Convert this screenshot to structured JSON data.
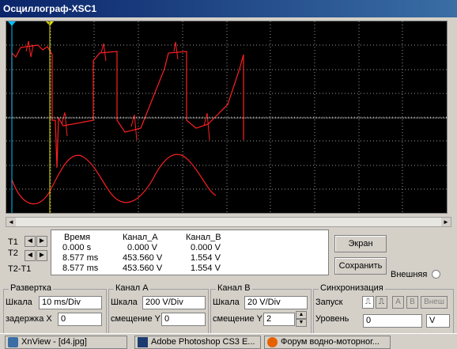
{
  "window": {
    "title": "Осциллограф-XSC1"
  },
  "screen": {
    "cursor1_label": "1",
    "cursor2_label": "2",
    "trace_color": "#ff2020",
    "grid_color": "#9a9a9a",
    "marker_color": "#e6e600"
  },
  "readout": {
    "row_labels": [
      "T1",
      "T2",
      "T2-T1"
    ],
    "headers": {
      "time": "Время",
      "chA": "Канал_A",
      "chB": "Канал_B"
    },
    "rows": [
      {
        "time": "0.000 s",
        "chA": "0.000 V",
        "chB": "0.000 V"
      },
      {
        "time": "8.577 ms",
        "chA": "453.560 V",
        "chB": "1.554 V"
      },
      {
        "time": "8.577 ms",
        "chA": "453.560 V",
        "chB": "1.554 V"
      }
    ]
  },
  "buttons": {
    "screen": "Экран",
    "save": "Сохранить",
    "external": "Внешняя"
  },
  "timebase": {
    "title": "Развертка",
    "scale_label": "Шкала",
    "scale_value": "10 ms/Div",
    "delay_label": "задержка X",
    "delay_value": "0"
  },
  "chA": {
    "title": "Канал А",
    "scale_label": "Шкала",
    "scale_value": "200  V/Div",
    "offset_label": "смещение Y",
    "offset_value": "0"
  },
  "chB": {
    "title": "Канал В",
    "scale_label": "Шкала",
    "scale_value": "20  V/Div",
    "offset_label": "смещение Y",
    "offset_value": "2"
  },
  "trigger": {
    "title": "Синхронизация",
    "start_label": "Запуск",
    "btn_a": "A",
    "btn_b": "B",
    "btn_ext": "Внеш",
    "level_label": "Уровень",
    "level_value": "0",
    "level_unit": "V"
  },
  "taskbar": [
    {
      "label": "XnView - [d4.jpg]",
      "icon": "xnview-icon"
    },
    {
      "label": "Adobe Photoshop CS3 E...",
      "icon": "photoshop-icon"
    },
    {
      "label": "Форум водно-моторног...",
      "icon": "firefox-icon"
    }
  ]
}
